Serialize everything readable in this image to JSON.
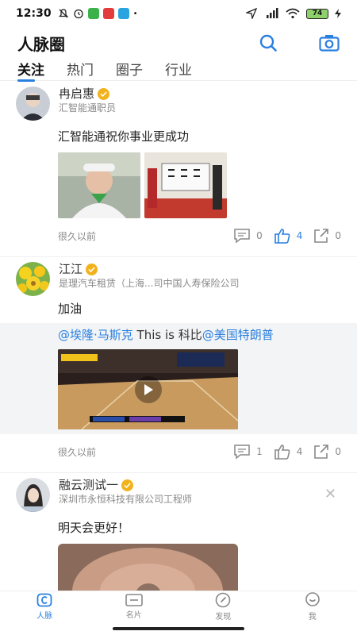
{
  "status": {
    "time": "12:30",
    "battery": "74"
  },
  "header": {
    "title": "人脉圈",
    "search_icon": "search-icon",
    "camera_icon": "camera-icon"
  },
  "tabs": [
    {
      "label": "关注",
      "active": true
    },
    {
      "label": "热门",
      "active": false
    },
    {
      "label": "圈子",
      "active": false
    },
    {
      "label": "行业",
      "active": false
    }
  ],
  "posts": [
    {
      "name": "冉启惠",
      "company": "汇智能通职员",
      "text": "汇智能通祝你事业更成功",
      "time": "很久以前",
      "comments": "0",
      "likes": "4",
      "shares": "0"
    },
    {
      "name": "江江",
      "company": "是理汽车租赁（上海...司中国人寿保险公司",
      "text": "加油",
      "forward_mention1": "@埃隆·马斯克",
      "forward_mid": " This is 科比",
      "forward_mention2": "@美国特朗普",
      "time": "很久以前",
      "comments": "1",
      "likes": "4",
      "shares": "0"
    },
    {
      "name": "融云测试一",
      "company": "深圳市永恒科技有限公司工程师",
      "text": "明天会更好！"
    }
  ],
  "nav": [
    {
      "label": "人脉",
      "active": true
    },
    {
      "label": "名片",
      "active": false
    },
    {
      "label": "发现",
      "active": false
    },
    {
      "label": "我",
      "active": false
    }
  ],
  "colors": {
    "accent": "#2a7fe0",
    "verified_badge": "#f2b21c"
  }
}
